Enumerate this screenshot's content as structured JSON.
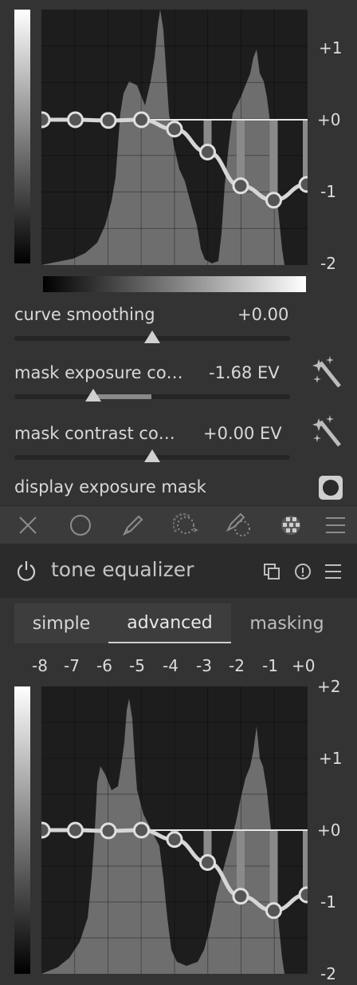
{
  "top_graph": {
    "y_labels": [
      "+1",
      "+0",
      "-1",
      "-2"
    ]
  },
  "sliders": [
    {
      "label": "curve smoothing",
      "value": "+0.00",
      "position": 0.5
    },
    {
      "label": "mask exposure co…",
      "value": "-1.68 EV",
      "position": 0.3
    },
    {
      "label": "mask contrast co…",
      "value": "+0.00 EV",
      "position": 0.5
    }
  ],
  "display_mask": {
    "label": "display exposure mask"
  },
  "toolbar": {
    "icons": [
      "close-icon",
      "circle-icon",
      "pencil-icon",
      "gradient-icon",
      "brush-icon",
      "parametric-mask-icon",
      "menu-icon"
    ]
  },
  "module": {
    "title": "tone equalizer",
    "icons": [
      "multi-instance-icon",
      "reset-icon",
      "presets-icon",
      "power-icon"
    ]
  },
  "tabs": [
    {
      "label": "simple",
      "active": false
    },
    {
      "label": "advanced",
      "active": true
    },
    {
      "label": "masking",
      "active": false
    }
  ],
  "bottom_graph": {
    "x_labels": [
      "-8",
      "-7",
      "-6",
      "-5",
      "-4",
      "-3",
      "-2",
      "-1",
      "+0"
    ],
    "y_labels": [
      "+2",
      "+1",
      "+0",
      "-1",
      "-2"
    ]
  },
  "curve": {
    "type": "line",
    "x": [
      -8,
      -7,
      -6,
      -5,
      -4,
      -3,
      -2,
      -1,
      0
    ],
    "values": [
      0.0,
      0.0,
      -0.01,
      0.0,
      -0.13,
      -0.45,
      -0.92,
      -1.12,
      -0.9
    ],
    "ylim": [
      -2,
      2
    ]
  },
  "colors": {
    "background": "#333333",
    "graph": "#1d1d1d",
    "curve": "#d6d6d6",
    "histogram": "#6e6e6e"
  }
}
